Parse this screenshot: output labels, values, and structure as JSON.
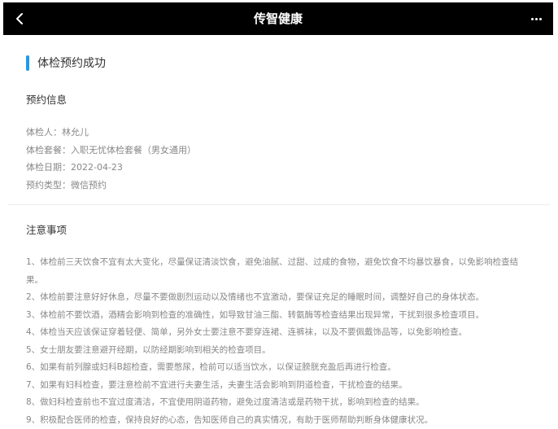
{
  "header": {
    "title": "传智健康",
    "back_icon": "chevron-left-icon",
    "more_icon": "more-horizontal-icon"
  },
  "section": {
    "title": "体检预约成功",
    "accent_color": "#1a9bf0"
  },
  "booking": {
    "heading": "预约信息",
    "items": [
      "体检人：林允儿",
      "体检套餐：入职无忧体检套餐（男女通用）",
      "体检日期：2022-04-23",
      "预约类型：微信预约"
    ]
  },
  "notes": {
    "heading": "注意事项",
    "items": [
      "1、体检前三天饮食不宜有太大变化，尽量保证清淡饮食，避免油腻、过甜、过咸的食物，避免饮食不均暴饮暴食，以免影响检查结果。",
      "2、体检前要注意好好休息，尽量不要做剧烈运动以及情绪也不宜激动，要保证充足的睡眠时间，调整好自己的身体状态。",
      "3、体检前不要饮酒，酒精会影响到检查的准确性，如导致甘油三酯、转氨酶等检查结果出现异常，干扰到很多检查项目。",
      "4、体检当天应该保证穿着轻便、简单，另外女士要注意不要穿连裙、连裤袜，以及不要佩戴饰品等，以免影响检查。",
      "5、女士朋友要注意避开经期，以防经期影响到相关的检查项目。",
      "6、如果有前列腺或妇科B超检查，需要憋尿，检前可以适当饮水，以保证膀胱充盈后再进行检查。",
      "7、如果有妇科检查，要注意检前不宜进行夫妻生活，夫妻生活会影响到阴道检查，干扰检查的结果。",
      "8、做妇科检查前也不宜过度清洁，不宜使用阴道药物，避免过度清洁或是药物干扰，影响到检查的结果。",
      "9、积极配合医师的检查，保持良好的心态，告知医师自己的真实情况，有助于医师帮助判断身体健康状况。"
    ]
  }
}
